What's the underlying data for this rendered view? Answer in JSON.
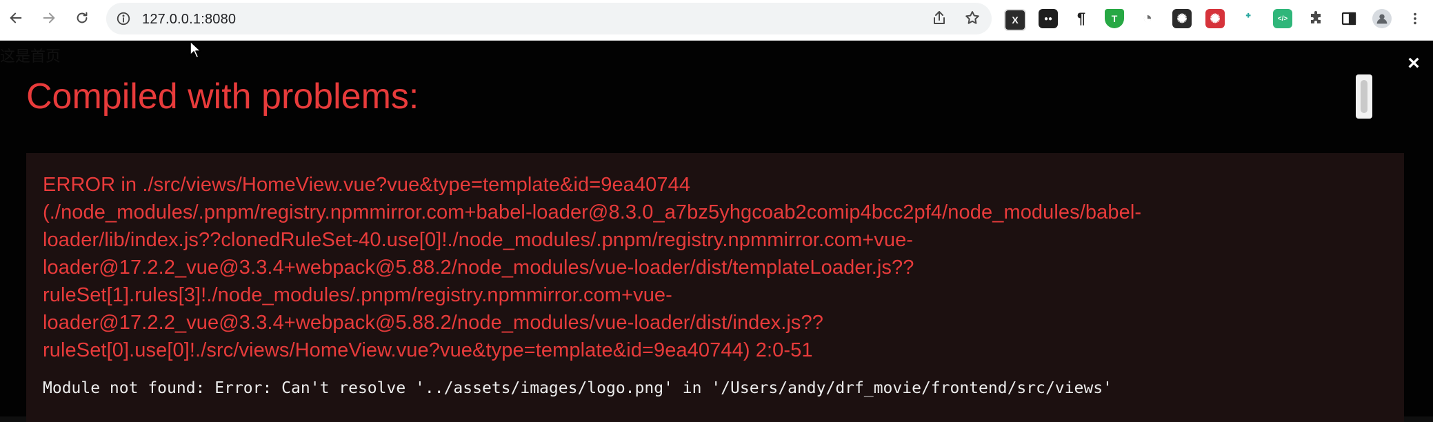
{
  "browser": {
    "url": "127.0.0.1:8080",
    "icons": [
      "back-icon",
      "forward-icon",
      "reload-icon",
      "site-info-icon",
      "share-icon",
      "bookmark-star-icon",
      "extensions-puzzle-icon",
      "side-panel-icon",
      "profile-icon",
      "menu-kebab-icon"
    ],
    "extensions": [
      {
        "name": "x-extension-icon",
        "glyph": "X",
        "color": "#2b2b2b"
      },
      {
        "name": "tampermonkey-icon",
        "glyph": "●●",
        "color": "#1f1f1f"
      },
      {
        "name": "paragraph-icon",
        "glyph": "¶",
        "color": "#ffffff"
      },
      {
        "name": "shield-t-icon",
        "glyph": "T",
        "color": "#27a844"
      },
      {
        "name": "tomato-icon",
        "glyph": "◔",
        "color": "#ffffff"
      },
      {
        "name": "chatgpt-icon",
        "glyph": "✺",
        "color": "#2b2b2b"
      },
      {
        "name": "openai-red-icon",
        "glyph": "✺",
        "color": "#d6333b"
      },
      {
        "name": "bird-icon",
        "glyph": "ᕀ",
        "color": "#ffffff"
      },
      {
        "name": "code-icon",
        "glyph": "</>",
        "color": "#2fb67a"
      }
    ]
  },
  "page": {
    "underlay_text": "这是首页"
  },
  "overlay": {
    "close_label": "×",
    "title": "Compiled with problems:",
    "error_lines": [
      "ERROR in ./src/views/HomeView.vue?vue&type=template&id=9ea40744",
      "(./node_modules/.pnpm/registry.npmmirror.com+babel-loader@8.3.0_a7bz5yhgcoab2comip4bcc2pf4/node_modules/babel-",
      "loader/lib/index.js??clonedRuleSet-40.use[0]!./node_modules/.pnpm/registry.npmmirror.com+vue-",
      "loader@17.2.2_vue@3.3.4+webpack@5.88.2/node_modules/vue-loader/dist/templateLoader.js??",
      "ruleSet[1].rules[3]!./node_modules/.pnpm/registry.npmmirror.com+vue-",
      "loader@17.2.2_vue@3.3.4+webpack@5.88.2/node_modules/vue-loader/dist/index.js??",
      "ruleSet[0].use[0]!./src/views/HomeView.vue?vue&type=template&id=9ea40744) 2:0-51"
    ],
    "detail": "Module not found: Error: Can't resolve '../assets/images/logo.png' in '/Users/andy/drf_movie/frontend/src/views'"
  },
  "colors": {
    "error_red": "#e83b3b",
    "overlay_bg": "#0f0f0f",
    "error_box_bg": "#1c1010",
    "detail_text": "#ececec"
  }
}
